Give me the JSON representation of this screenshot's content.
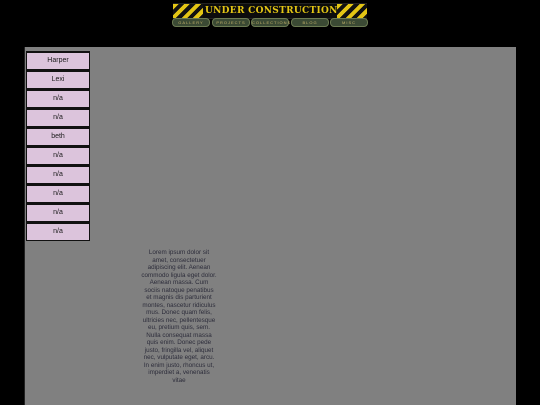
{
  "header": {
    "title": "UNDER CONSTRUCTION",
    "nav": [
      {
        "label": "Gallery"
      },
      {
        "label": "Projects"
      },
      {
        "label": "Collections"
      },
      {
        "label": "Blog"
      },
      {
        "label": "Misc"
      }
    ]
  },
  "sidebar": {
    "items": [
      {
        "label": "Harper"
      },
      {
        "label": "Lexi"
      },
      {
        "label": "n/a"
      },
      {
        "label": "n/a"
      },
      {
        "label": "beth"
      },
      {
        "label": "n/a"
      },
      {
        "label": "n/a"
      },
      {
        "label": "n/a"
      },
      {
        "label": "n/a"
      },
      {
        "label": "n/a"
      }
    ]
  },
  "main": {
    "body_text": "Lorem ipsum dolor sit amet, consectetuer adipiscing elit. Aenean commodo ligula eget dolor. Aenean massa. Cum sociis natoque penatibus et magnis dis parturient montes, nascetur ridiculus mus. Donec quam felis, ultricies nec, pellentesque eu, pretium quis, sem. Nulla consequat massa quis enim. Donec pede justo, fringilla vel, aliquet nec, vulputate eget, arcu. In enim justo, rhoncus ut, imperdiet a, venenatis vitae"
  },
  "colors": {
    "background": "#000000",
    "panel": "#808080",
    "sidebar_item": "#dcc4dc",
    "banner_text": "#e3c514"
  }
}
